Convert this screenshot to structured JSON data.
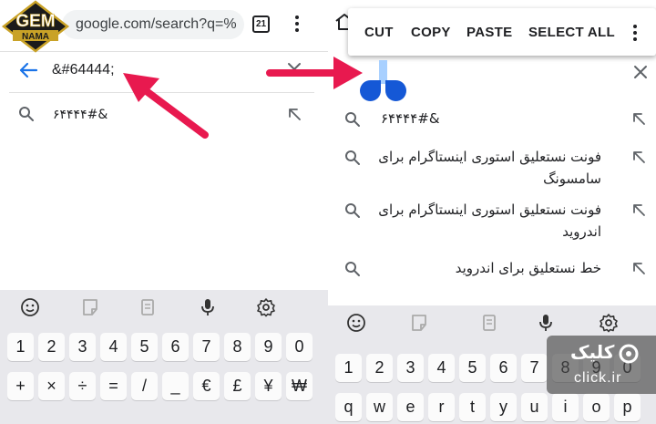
{
  "left": {
    "url_text": "google.com/search?q=%",
    "tab_count": "21",
    "query_value": "&#64444;",
    "suggestion": "۶۴۴۴۴#&",
    "keyboard": {
      "row1": [
        "1",
        "2",
        "3",
        "4",
        "5",
        "6",
        "7",
        "8",
        "9",
        "0"
      ],
      "row2": [
        "+",
        "×",
        "÷",
        "=",
        "/",
        "_",
        "€",
        "£",
        "¥",
        "₩"
      ]
    }
  },
  "right": {
    "context_menu": {
      "cut": "CUT",
      "copy": "COPY",
      "paste": "PASTE",
      "select_all": "SELECT ALL"
    },
    "suggestions": [
      {
        "text": "۶۴۴۴۴#&"
      },
      {
        "text": "فونت نستعلیق استوری اینستاگرام برای سامسونگ"
      },
      {
        "text": "فونت نستعلیق استوری اینستاگرام برای اندروید"
      },
      {
        "text": "خط نستعلیق برای اندروید"
      }
    ],
    "keyboard": {
      "row1": [
        "1",
        "2",
        "3",
        "4",
        "5",
        "6",
        "7",
        "8",
        "9",
        "0"
      ],
      "row2_partial": [
        "q",
        "w",
        "e",
        "r",
        "t",
        "y",
        "u",
        "i",
        "o",
        "p"
      ]
    }
  },
  "logo": {
    "line1": "GEM",
    "line2": "NAMA"
  },
  "watermark": {
    "title": "کلیک",
    "domain": "click.ir"
  },
  "colors": {
    "arrow_red": "#e8194f",
    "accent_blue": "#1a73e8",
    "handle_blue": "#1558d6",
    "cursor_blue": "#a8d0ff",
    "keyboard_bg": "#e8e8ec",
    "gold": "#c9a227"
  }
}
